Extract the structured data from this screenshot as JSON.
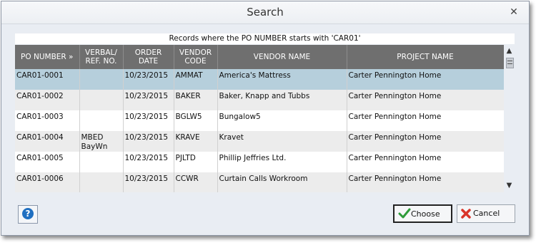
{
  "dialog": {
    "title": "Search",
    "close_glyph": "✕",
    "caption": "Records where the PO NUMBER starts with 'CAR01'"
  },
  "table": {
    "columns": [
      "PO NUMBER »",
      "VERBAL/\nREF. NO.",
      "ORDER DATE",
      "VENDOR\nCODE",
      "VENDOR NAME",
      "PROJECT NAME"
    ],
    "rows": [
      {
        "po": "CAR01-0001",
        "ref": "",
        "date": "10/23/2015",
        "code": "AMMAT",
        "vendor": "America's Mattress",
        "project": "Carter Pennington Home"
      },
      {
        "po": "CAR01-0002",
        "ref": "",
        "date": "10/23/2015",
        "code": "BAKER",
        "vendor": "Baker, Knapp and Tubbs",
        "project": "Carter Pennington Home"
      },
      {
        "po": "CAR01-0003",
        "ref": "",
        "date": "10/23/2015",
        "code": "BGLW5",
        "vendor": "Bungalow5",
        "project": "Carter Pennington Home"
      },
      {
        "po": "CAR01-0004",
        "ref": "MBED\nBayWn",
        "date": "10/23/2015",
        "code": "KRAVE",
        "vendor": "Kravet",
        "project": "Carter Pennington Home"
      },
      {
        "po": "CAR01-0005",
        "ref": "",
        "date": "10/23/2015",
        "code": "PJLTD",
        "vendor": "Phillip Jeffries Ltd.",
        "project": "Carter Pennington Home"
      },
      {
        "po": "CAR01-0006",
        "ref": "",
        "date": "10/23/2015",
        "code": "CCWR",
        "vendor": "Curtain Calls Workroom",
        "project": "Carter Pennington Home"
      }
    ],
    "selected_row": 0
  },
  "scrollbar": {
    "up_glyph": "▲",
    "down_glyph": "▼"
  },
  "buttons": {
    "help_glyph": "?",
    "choose_label": "Choose",
    "cancel_label": "Cancel"
  },
  "icons": {
    "help": "help-circle-icon",
    "choose": "green-check-icon",
    "cancel": "red-x-icon"
  },
  "colors": {
    "header_bg": "#6f6f6f",
    "selected_row": "#b6cfdc",
    "alt_row": "#ececec",
    "check": "#2e9b3a",
    "cancel": "#d9352a",
    "help": "#1f6fc1"
  }
}
